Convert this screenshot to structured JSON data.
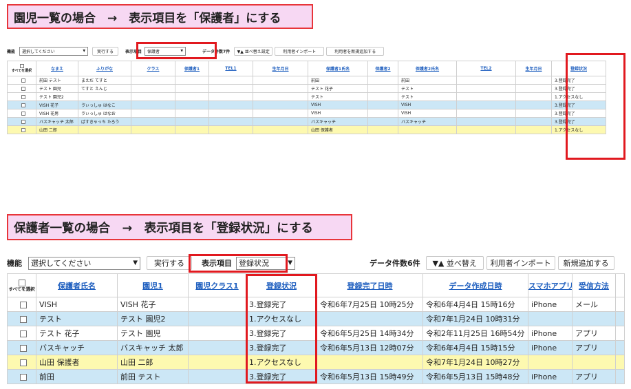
{
  "section1": {
    "title": "園児一覧の場合　→　表示項目を「保護者」にする",
    "toolbar": {
      "func_label": "機能",
      "func_select": "選択してください",
      "run_button": "実行する",
      "display_label": "表示項目",
      "display_select": "保護者",
      "count_text": "データ件数7件",
      "sort_button": "▼▲ 並べ替え設定",
      "import_button": "利用者インポート",
      "add_button": "利用者を新規追加する"
    },
    "table": {
      "select_all": "すべてを選択",
      "headers": [
        "なまえ",
        "ふりがな",
        "クラス",
        "保護者1",
        "TEL1",
        "生年月日",
        "保護者1氏名",
        "保護者2",
        "保護者2氏名",
        "TEL2",
        "生年月日",
        "登録状況"
      ],
      "rows": [
        {
          "cells": [
            "前田 テスト",
            "まえだ てすと",
            "",
            "",
            "",
            "",
            "前田",
            "",
            "前田",
            "",
            "",
            "3.登録完了"
          ]
        },
        {
          "cells": [
            "テスト 園児",
            "てすと えんじ",
            "",
            "",
            "",
            "",
            "テスト 花子",
            "",
            "テスト",
            "",
            "",
            "3.登録完了"
          ]
        },
        {
          "cells": [
            "テスト 園児2",
            "",
            "",
            "",
            "",
            "",
            "テスト",
            "",
            "テスト",
            "",
            "",
            "1.アクセスなし"
          ]
        },
        {
          "cells": [
            "VISH 花子",
            "ゔぃっしゅ はなこ",
            "",
            "",
            "",
            "",
            "VISH",
            "",
            "VISH",
            "",
            "",
            "3.登録完了"
          ]
        },
        {
          "cells": [
            "VISH 花男",
            "ゔぃっしゅ はなお",
            "",
            "",
            "",
            "",
            "VISH",
            "",
            "VISH",
            "",
            "",
            "3.登録完了"
          ]
        },
        {
          "cells": [
            "バスキャッチ 太郎",
            "ばすきゃっち たろう",
            "",
            "",
            "",
            "",
            "バスキャッチ",
            "",
            "バスキャッチ",
            "",
            "",
            "3.登録完了"
          ]
        },
        {
          "cells": [
            "山田 二郎",
            "",
            "",
            "",
            "",
            "",
            "山田 保護者",
            "",
            "",
            "",
            "",
            "1.アクセスなし"
          ]
        }
      ]
    }
  },
  "section2": {
    "title": "保護者一覧の場合　→　表示項目を「登録状況」にする",
    "toolbar": {
      "func_label": "機能",
      "func_select": "選択してください",
      "run_button": "実行する",
      "display_label": "表示項目",
      "display_select": "登録状況",
      "count_text": "データ件数6件",
      "sort_button": "▼▲ 並べ替え",
      "import_button": "利用者インポート",
      "add_button": "新規追加する"
    },
    "table": {
      "select_all": "すべてを選択",
      "headers": [
        "保護者氏名",
        "園児1",
        "園児クラス1",
        "登録状況",
        "登録完了日時",
        "データ作成日時",
        "スマホアプリ",
        "受信方法"
      ],
      "rows": [
        {
          "cells": [
            "VISH",
            "VISH 花子",
            "",
            "3.登録完了",
            "令和6年7月25日 10時25分",
            "令和6年4月4日 15時16分",
            "iPhone",
            "メール"
          ]
        },
        {
          "cells": [
            "テスト",
            "テスト 園児2",
            "",
            "1.アクセスなし",
            "",
            "令和7年1月24日 10時31分",
            "",
            ""
          ]
        },
        {
          "cells": [
            "テスト 花子",
            "テスト 園児",
            "",
            "3.登録完了",
            "令和6年5月25日 14時34分",
            "令和2年11月25日 16時54分",
            "iPhone",
            "アプリ"
          ]
        },
        {
          "cells": [
            "バスキャッチ",
            "バスキャッチ 太郎",
            "",
            "3.登録完了",
            "令和6年5月13日 12時07分",
            "令和6年4月4日 15時15分",
            "iPhone",
            "アプリ"
          ]
        },
        {
          "cells": [
            "山田 保護者",
            "山田 二郎",
            "",
            "1.アクセスなし",
            "",
            "令和7年1月24日 10時27分",
            "",
            ""
          ]
        },
        {
          "cells": [
            "前田",
            "前田 テスト",
            "",
            "3.登録完了",
            "令和6年5月13日 15時49分",
            "令和6年5月13日 15時48分",
            "iPhone",
            "アプリ"
          ]
        }
      ]
    }
  },
  "colors": {
    "banner_bg": "#f7d8f3",
    "highlight_border": "#e1191f",
    "row_blue": "#cce7f6",
    "row_yellow": "#fdf9b0",
    "link_blue": "#1f5fbf"
  },
  "icons": [
    "chevron-down-icon",
    "checkbox-icon"
  ]
}
